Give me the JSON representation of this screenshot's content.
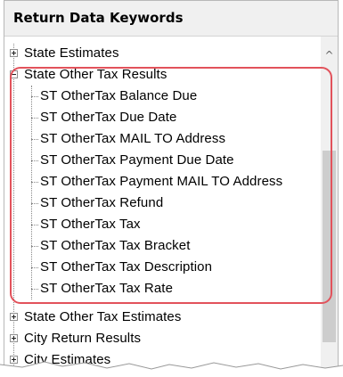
{
  "panel": {
    "title": "Return Data Keywords"
  },
  "tree": {
    "items": [
      {
        "label": "State Estimates",
        "expander": "plus"
      },
      {
        "label": "State Other Tax Results",
        "expander": "minus"
      },
      {
        "label": "ST OtherTax Balance Due"
      },
      {
        "label": "ST OtherTax Due Date"
      },
      {
        "label": "ST OtherTax MAIL TO Address"
      },
      {
        "label": "ST OtherTax Payment Due Date"
      },
      {
        "label": "ST OtherTax Payment MAIL TO Address"
      },
      {
        "label": "ST OtherTax Refund"
      },
      {
        "label": "ST OtherTax Tax"
      },
      {
        "label": "ST OtherTax Tax Bracket"
      },
      {
        "label": "ST OtherTax Tax Description"
      },
      {
        "label": "ST OtherTax Tax Rate"
      },
      {
        "label": "State Other Tax Estimates",
        "expander": "plus"
      },
      {
        "label": "City Return Results",
        "expander": "plus"
      },
      {
        "label": "City Estimates",
        "expander": "plus"
      }
    ]
  },
  "scrollbar": {
    "up_arrow": "^"
  },
  "colors": {
    "highlight": "#e2525b",
    "header_bg": "#f0f0f0"
  }
}
